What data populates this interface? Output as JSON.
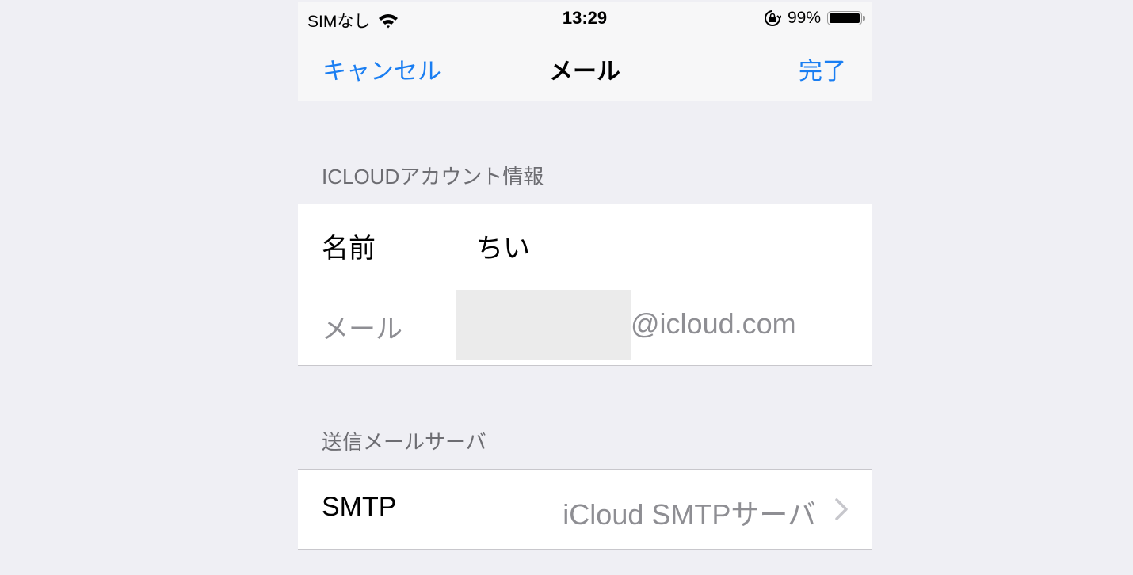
{
  "status_bar": {
    "carrier": "SIMなし",
    "wifi_icon": "wifi-icon",
    "time": "13:29",
    "orientation_lock_icon": "orientation-lock-icon",
    "battery_percent": "99%",
    "battery_level": 0.99
  },
  "nav": {
    "cancel_label": "キャンセル",
    "title": "メール",
    "done_label": "完了",
    "accent_color": "#1a7ef2"
  },
  "account_section": {
    "header": "ICLOUDアカウント情報",
    "rows": [
      {
        "label": "名前",
        "value": "ちい"
      },
      {
        "label": "メール",
        "value_masked": true,
        "value_suffix": "@icloud.com"
      }
    ]
  },
  "smtp_section": {
    "header": "送信メールサーバ",
    "rows": [
      {
        "label": "SMTP",
        "value": "iCloud SMTPサーバ",
        "accessory_icon": "chevron-right-icon"
      }
    ]
  }
}
